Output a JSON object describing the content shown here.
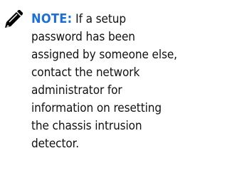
{
  "note": {
    "label": "NOTE:",
    "lines": [
      " If a setup",
      "password has been",
      "assigned by someone else,",
      "contact the network",
      "administrator for",
      "information on resetting",
      "the chassis intrusion",
      "detector."
    ]
  },
  "colors": {
    "label": "#1c6fd6",
    "text": "#111111",
    "icon": "#000000"
  },
  "icon": "pencil-note-icon"
}
